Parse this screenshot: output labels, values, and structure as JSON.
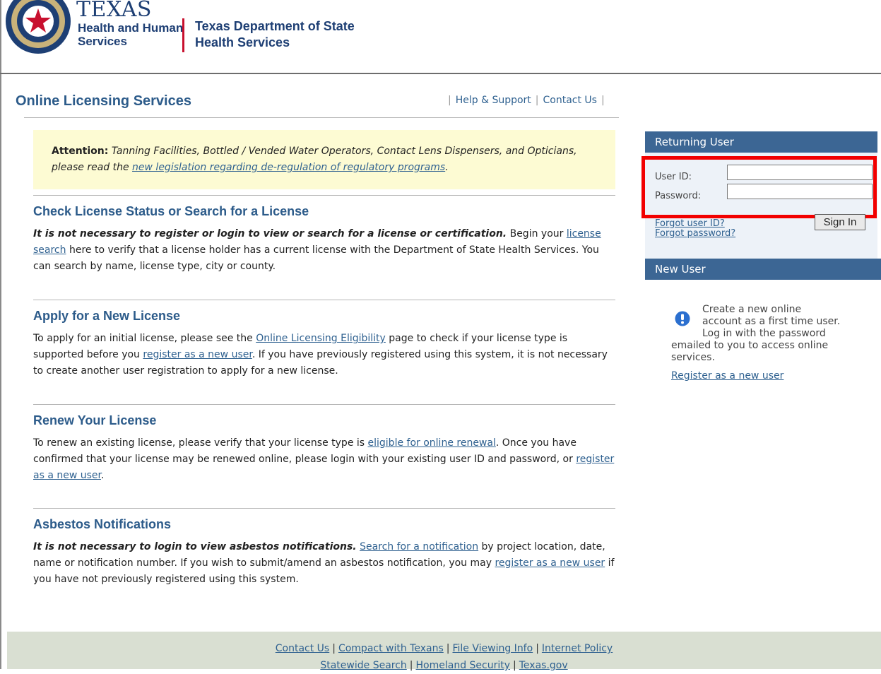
{
  "header": {
    "brand_texas": "TEXAS",
    "brand_hhs_line1": "Health and Human",
    "brand_hhs_line2": "Services",
    "dept_line1": "Texas Department of State",
    "dept_line2": "Health Services"
  },
  "title": "Online Licensing Services",
  "top_links": [
    "Help & Support",
    "Contact Us"
  ],
  "notice": {
    "label": "Attention:",
    "text": "Tanning Facilities, Bottled / Vended Water Operators, Contact Lens Dispensers, and Opticians, please read the ",
    "link": "new legislation regarding de-regulation of regulatory programs",
    "end": "."
  },
  "sections": {
    "check": {
      "title": "Check License Status or Search for a License",
      "lead": "It is not necessary to register or login to view or search for a license or certification.",
      "t1": " Begin your ",
      "link1": "license search",
      "t2": " here to verify that a license holder has a current license with the Department of State Health Services. You can search by name, license type, city or county."
    },
    "apply": {
      "title": "Apply for a New License",
      "t1": "To apply for an initial license, please see the ",
      "link1": "Online Licensing Eligibility",
      "t2": " page to check if your license type is supported before you ",
      "link2": "register as a new user",
      "t3": ". If you have previously registered using this system, it is not necessary to create another user registration to apply for a new license."
    },
    "renew": {
      "title": "Renew Your License",
      "t1": "To renew an existing license, please verify that your license type is ",
      "link1": "eligible for online renewal",
      "t2": ". Once you have confirmed that your license may be renewed online, please login with your existing user ID and password, or ",
      "link2": "register as a new user",
      "t3": "."
    },
    "asbestos": {
      "title": "Asbestos Notifications",
      "lead": "It is not necessary to login to view asbestos notifications.",
      "t1": " ",
      "link1": "Search for a notification",
      "t2": " by project location, date, name or notification number. If you wish to submit/amend an asbestos notification, you may ",
      "link2": "register as a new user",
      "t3": " if you have not previously registered using this system."
    }
  },
  "login": {
    "heading": "Returning User",
    "user_id_label": "User ID:",
    "password_label": "Password:",
    "user_id_value": "",
    "password_value": "",
    "forgot_user": "Forgot user ID?",
    "forgot_password": "Forgot password?",
    "sign_in": "Sign In"
  },
  "new_user": {
    "heading": "New User",
    "line1": "Create a new online",
    "line2": "account as a first time user.",
    "line3": "Log in with the password",
    "line4": "emailed to you to access online",
    "line5": "services.",
    "register_link": "Register as a new user",
    "icon": "info-icon"
  },
  "footer": {
    "row1": [
      "Contact Us",
      "Compact with Texans",
      "File Viewing Info",
      "Internet Policy"
    ],
    "row2": [
      "Statewide Search",
      "Homeland Security",
      "Texas.gov"
    ]
  },
  "colors": {
    "brand_blue": "#1e3f74",
    "accent_red": "#c8102e",
    "panel_header": "#3c6694",
    "notice_bg": "#fdfbd3",
    "footer_bg": "#d9dfd2",
    "highlight": "#f20000"
  }
}
